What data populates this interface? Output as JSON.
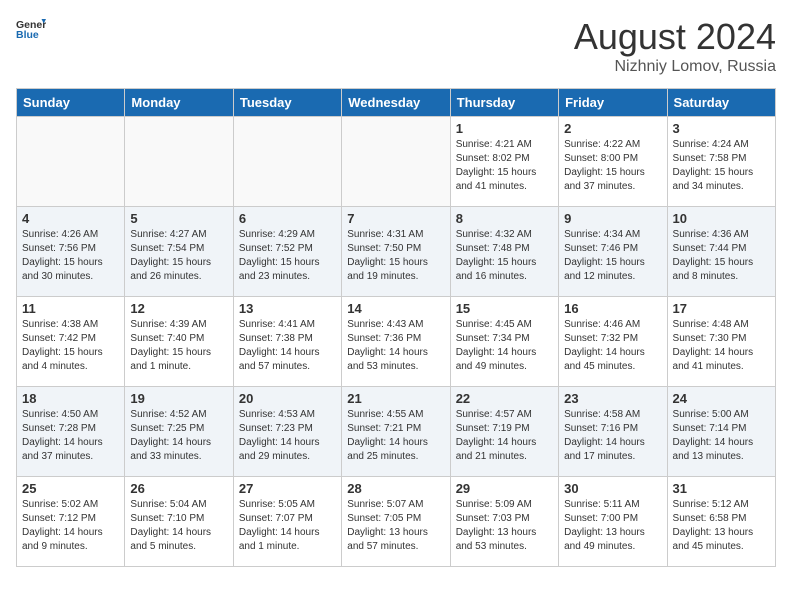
{
  "header": {
    "logo_general": "General",
    "logo_blue": "Blue",
    "month_year": "August 2024",
    "location": "Nizhniy Lomov, Russia"
  },
  "weekdays": [
    "Sunday",
    "Monday",
    "Tuesday",
    "Wednesday",
    "Thursday",
    "Friday",
    "Saturday"
  ],
  "weeks": [
    [
      {
        "date": "",
        "sunrise": "",
        "sunset": "",
        "daylight": "",
        "empty": true
      },
      {
        "date": "",
        "sunrise": "",
        "sunset": "",
        "daylight": "",
        "empty": true
      },
      {
        "date": "",
        "sunrise": "",
        "sunset": "",
        "daylight": "",
        "empty": true
      },
      {
        "date": "",
        "sunrise": "",
        "sunset": "",
        "daylight": "",
        "empty": true
      },
      {
        "date": "1",
        "sunrise": "Sunrise: 4:21 AM",
        "sunset": "Sunset: 8:02 PM",
        "daylight": "Daylight: 15 hours and 41 minutes.",
        "empty": false
      },
      {
        "date": "2",
        "sunrise": "Sunrise: 4:22 AM",
        "sunset": "Sunset: 8:00 PM",
        "daylight": "Daylight: 15 hours and 37 minutes.",
        "empty": false
      },
      {
        "date": "3",
        "sunrise": "Sunrise: 4:24 AM",
        "sunset": "Sunset: 7:58 PM",
        "daylight": "Daylight: 15 hours and 34 minutes.",
        "empty": false
      }
    ],
    [
      {
        "date": "4",
        "sunrise": "Sunrise: 4:26 AM",
        "sunset": "Sunset: 7:56 PM",
        "daylight": "Daylight: 15 hours and 30 minutes.",
        "empty": false
      },
      {
        "date": "5",
        "sunrise": "Sunrise: 4:27 AM",
        "sunset": "Sunset: 7:54 PM",
        "daylight": "Daylight: 15 hours and 26 minutes.",
        "empty": false
      },
      {
        "date": "6",
        "sunrise": "Sunrise: 4:29 AM",
        "sunset": "Sunset: 7:52 PM",
        "daylight": "Daylight: 15 hours and 23 minutes.",
        "empty": false
      },
      {
        "date": "7",
        "sunrise": "Sunrise: 4:31 AM",
        "sunset": "Sunset: 7:50 PM",
        "daylight": "Daylight: 15 hours and 19 minutes.",
        "empty": false
      },
      {
        "date": "8",
        "sunrise": "Sunrise: 4:32 AM",
        "sunset": "Sunset: 7:48 PM",
        "daylight": "Daylight: 15 hours and 16 minutes.",
        "empty": false
      },
      {
        "date": "9",
        "sunrise": "Sunrise: 4:34 AM",
        "sunset": "Sunset: 7:46 PM",
        "daylight": "Daylight: 15 hours and 12 minutes.",
        "empty": false
      },
      {
        "date": "10",
        "sunrise": "Sunrise: 4:36 AM",
        "sunset": "Sunset: 7:44 PM",
        "daylight": "Daylight: 15 hours and 8 minutes.",
        "empty": false
      }
    ],
    [
      {
        "date": "11",
        "sunrise": "Sunrise: 4:38 AM",
        "sunset": "Sunset: 7:42 PM",
        "daylight": "Daylight: 15 hours and 4 minutes.",
        "empty": false
      },
      {
        "date": "12",
        "sunrise": "Sunrise: 4:39 AM",
        "sunset": "Sunset: 7:40 PM",
        "daylight": "Daylight: 15 hours and 1 minute.",
        "empty": false
      },
      {
        "date": "13",
        "sunrise": "Sunrise: 4:41 AM",
        "sunset": "Sunset: 7:38 PM",
        "daylight": "Daylight: 14 hours and 57 minutes.",
        "empty": false
      },
      {
        "date": "14",
        "sunrise": "Sunrise: 4:43 AM",
        "sunset": "Sunset: 7:36 PM",
        "daylight": "Daylight: 14 hours and 53 minutes.",
        "empty": false
      },
      {
        "date": "15",
        "sunrise": "Sunrise: 4:45 AM",
        "sunset": "Sunset: 7:34 PM",
        "daylight": "Daylight: 14 hours and 49 minutes.",
        "empty": false
      },
      {
        "date": "16",
        "sunrise": "Sunrise: 4:46 AM",
        "sunset": "Sunset: 7:32 PM",
        "daylight": "Daylight: 14 hours and 45 minutes.",
        "empty": false
      },
      {
        "date": "17",
        "sunrise": "Sunrise: 4:48 AM",
        "sunset": "Sunset: 7:30 PM",
        "daylight": "Daylight: 14 hours and 41 minutes.",
        "empty": false
      }
    ],
    [
      {
        "date": "18",
        "sunrise": "Sunrise: 4:50 AM",
        "sunset": "Sunset: 7:28 PM",
        "daylight": "Daylight: 14 hours and 37 minutes.",
        "empty": false
      },
      {
        "date": "19",
        "sunrise": "Sunrise: 4:52 AM",
        "sunset": "Sunset: 7:25 PM",
        "daylight": "Daylight: 14 hours and 33 minutes.",
        "empty": false
      },
      {
        "date": "20",
        "sunrise": "Sunrise: 4:53 AM",
        "sunset": "Sunset: 7:23 PM",
        "daylight": "Daylight: 14 hours and 29 minutes.",
        "empty": false
      },
      {
        "date": "21",
        "sunrise": "Sunrise: 4:55 AM",
        "sunset": "Sunset: 7:21 PM",
        "daylight": "Daylight: 14 hours and 25 minutes.",
        "empty": false
      },
      {
        "date": "22",
        "sunrise": "Sunrise: 4:57 AM",
        "sunset": "Sunset: 7:19 PM",
        "daylight": "Daylight: 14 hours and 21 minutes.",
        "empty": false
      },
      {
        "date": "23",
        "sunrise": "Sunrise: 4:58 AM",
        "sunset": "Sunset: 7:16 PM",
        "daylight": "Daylight: 14 hours and 17 minutes.",
        "empty": false
      },
      {
        "date": "24",
        "sunrise": "Sunrise: 5:00 AM",
        "sunset": "Sunset: 7:14 PM",
        "daylight": "Daylight: 14 hours and 13 minutes.",
        "empty": false
      }
    ],
    [
      {
        "date": "25",
        "sunrise": "Sunrise: 5:02 AM",
        "sunset": "Sunset: 7:12 PM",
        "daylight": "Daylight: 14 hours and 9 minutes.",
        "empty": false
      },
      {
        "date": "26",
        "sunrise": "Sunrise: 5:04 AM",
        "sunset": "Sunset: 7:10 PM",
        "daylight": "Daylight: 14 hours and 5 minutes.",
        "empty": false
      },
      {
        "date": "27",
        "sunrise": "Sunrise: 5:05 AM",
        "sunset": "Sunset: 7:07 PM",
        "daylight": "Daylight: 14 hours and 1 minute.",
        "empty": false
      },
      {
        "date": "28",
        "sunrise": "Sunrise: 5:07 AM",
        "sunset": "Sunset: 7:05 PM",
        "daylight": "Daylight: 13 hours and 57 minutes.",
        "empty": false
      },
      {
        "date": "29",
        "sunrise": "Sunrise: 5:09 AM",
        "sunset": "Sunset: 7:03 PM",
        "daylight": "Daylight: 13 hours and 53 minutes.",
        "empty": false
      },
      {
        "date": "30",
        "sunrise": "Sunrise: 5:11 AM",
        "sunset": "Sunset: 7:00 PM",
        "daylight": "Daylight: 13 hours and 49 minutes.",
        "empty": false
      },
      {
        "date": "31",
        "sunrise": "Sunrise: 5:12 AM",
        "sunset": "Sunset: 6:58 PM",
        "daylight": "Daylight: 13 hours and 45 minutes.",
        "empty": false
      }
    ]
  ]
}
